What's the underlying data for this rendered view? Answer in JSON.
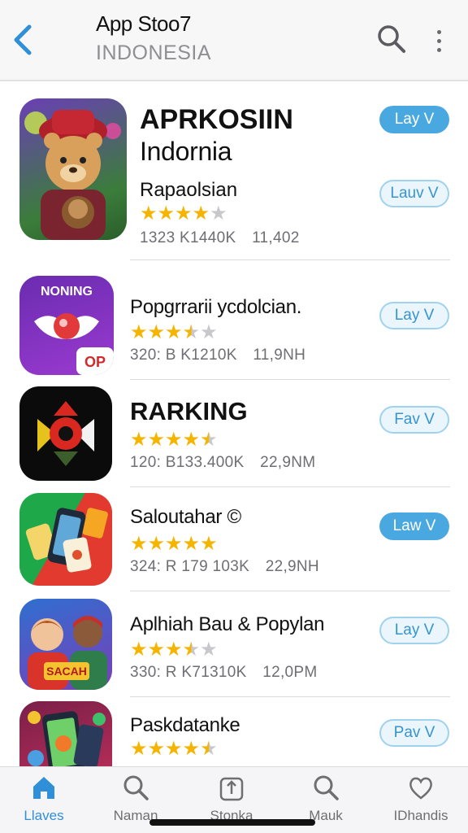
{
  "header": {
    "title": "App Stoo7",
    "subtitle": "INDONESIA",
    "back_icon": "chevron-left-icon",
    "search_icon": "search-icon",
    "more_icon": "more-vertical-icon",
    "accent": "#2f8fd8"
  },
  "apps": [
    {
      "name_line1": "APRKOSIIN",
      "name_line2": "Indornia",
      "category": "Rapaolsian",
      "rating": 4,
      "meta_a": "1323 K1440K",
      "meta_b": "11,402",
      "buttons": [
        "Lay V",
        "Lauv V"
      ]
    },
    {
      "name": "Popgrrarii ycdolcian.",
      "icon_text": "NONING",
      "icon_badge": "OP",
      "rating": 3.5,
      "meta_a": "320: B K1210K",
      "meta_b": "11,9NH",
      "button": "Lay V"
    },
    {
      "name": "RARKING",
      "rating": 4.5,
      "meta_a": "120: B133.400K",
      "meta_b": "22,9NM",
      "button": "Fav V"
    },
    {
      "name": "Saloutahar ©",
      "rating": 5,
      "meta_a": "324: R 179 103K",
      "meta_b": "22,9NH",
      "button": "Law V"
    },
    {
      "name": "Aplhiah Bau & Popylan",
      "icon_text": "SACAH",
      "rating": 3.5,
      "meta_a": "330: R K71310K",
      "meta_b": "12,0PM",
      "button": "Lay V"
    },
    {
      "name": "Paskdatanke",
      "rating": 4.5,
      "meta_a": "",
      "meta_b": "",
      "button": "Pav V"
    }
  ],
  "tabs": [
    {
      "label": "Llaves",
      "icon": "home-icon",
      "active": true
    },
    {
      "label": "Naman",
      "icon": "search-icon",
      "active": false
    },
    {
      "label": "Stonka",
      "icon": "share-box-icon",
      "active": false
    },
    {
      "label": "Mauk",
      "icon": "search-icon",
      "active": false
    },
    {
      "label": "IDhandis",
      "icon": "heart-icon",
      "active": false
    }
  ],
  "colors": {
    "star": "#f4b400",
    "star_empty": "#c7c7cc",
    "button_filled": "#4aa8e0",
    "button_outline": "#9fd2ef"
  }
}
